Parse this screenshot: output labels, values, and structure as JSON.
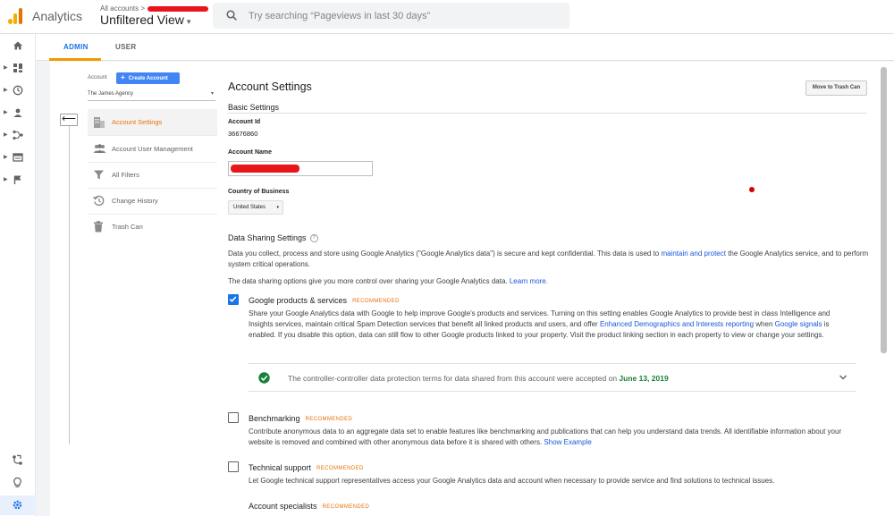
{
  "header": {
    "app_title": "Analytics",
    "account_path": "All accounts",
    "account_path_sep": ">",
    "view_name": "Unfiltered View",
    "view_caret": "▾",
    "search_placeholder": "Try searching “Pageviews in last 30 days”"
  },
  "tabs": {
    "admin": "ADMIN",
    "user": "USER"
  },
  "account": {
    "label": "Account",
    "create_button": "Create Account",
    "create_plus": "+",
    "selected": "The James Agency",
    "select_caret": "▾",
    "back_arrow": "⟵"
  },
  "menu": [
    {
      "label": "Account Settings",
      "icon": "building-icon",
      "active": true
    },
    {
      "label": "Account User Management",
      "icon": "users-icon",
      "active": false
    },
    {
      "label": "All Filters",
      "icon": "filter-icon",
      "active": false
    },
    {
      "label": "Change History",
      "icon": "history-icon",
      "active": false
    },
    {
      "label": "Trash Can",
      "icon": "trash-icon",
      "active": false
    }
  ],
  "settings": {
    "title": "Account Settings",
    "trash_button": "Move to Trash Can",
    "basic_settings": "Basic Settings",
    "account_id_label": "Account Id",
    "account_id_value": "36676860",
    "account_name_label": "Account Name",
    "country_label": "Country of Business",
    "country_value": "United States",
    "country_caret": "▾"
  },
  "data_sharing": {
    "title": "Data Sharing Settings",
    "help_icon": "?",
    "intro_part1": "Data you collect, process and store using Google Analytics (\"Google Analytics data\") is secure and kept confidential. This data is used to ",
    "intro_link": "maintain and protect",
    "intro_part2": " the Google Analytics service, and to perform system critical operations.",
    "control_text": "The data sharing options give you more control over sharing your Google Analytics data. ",
    "control_link": "Learn more.",
    "recommended": "RECOMMENDED",
    "google_products": {
      "title": "Google products & services",
      "checked": true,
      "desc_part1": "Share your Google Analytics data with Google to help improve Google's products and services. Turning on this setting enables Google Analytics to provide best in class Intelligence and Insights services, maintain critical Spam Detection services that benefit all linked products and users, and offer ",
      "desc_link1": "Enhanced Demographics and Interests reporting",
      "desc_part2": " when ",
      "desc_link2": "Google signals",
      "desc_part3": " is enabled. If you disable this option, data can still flow to other Google products linked to your property. Visit the product linking section in each property to view or change your settings."
    },
    "acceptance": {
      "text": "The controller-controller data protection terms for data shared from this account were accepted on ",
      "date": "June 13, 2019"
    },
    "benchmarking": {
      "title": "Benchmarking",
      "checked": false,
      "desc": "Contribute anonymous data to an aggregate data set to enable features like benchmarking and publications that can help you understand data trends. All identifiable information about your website is removed and combined with other anonymous data before it is shared with others. ",
      "link": "Show Example"
    },
    "technical_support": {
      "title": "Technical support",
      "checked": false,
      "desc": "Let Google technical support representatives access your Google Analytics data and account when necessary to provide service and find solutions to technical issues."
    },
    "account_specialists": {
      "title": "Account specialists"
    }
  },
  "colors": {
    "accent": "#1a73e8",
    "active_menu": "#e8710a",
    "recommended": "#e8710a",
    "success": "#188038",
    "redaction": "#e8151b"
  }
}
